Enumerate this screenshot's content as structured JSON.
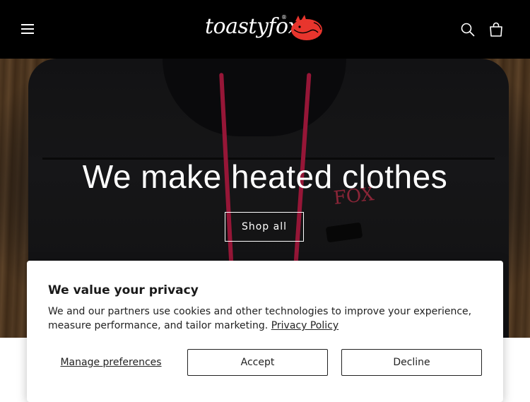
{
  "header": {
    "logo_text": "toastyfox",
    "logo_reg": "®",
    "menu_icon": "hamburger-menu-icon",
    "search_icon": "search-icon",
    "cart_icon": "cart-icon"
  },
  "hero": {
    "title": "We make heated clothes",
    "cta_label": "Shop all",
    "embroidery": "FOX"
  },
  "cookie_banner": {
    "title": "We value your privacy",
    "body": "We and our partners use cookies and other technologies to improve your experience, measure performance, and tailor marketing.",
    "policy_link": "Privacy Policy",
    "manage_label": "Manage preferences",
    "accept_label": "Accept",
    "decline_label": "Decline"
  },
  "colors": {
    "header_bg": "#000000",
    "accent_fox": "#e8352d",
    "drawstring": "#c81e4a"
  }
}
